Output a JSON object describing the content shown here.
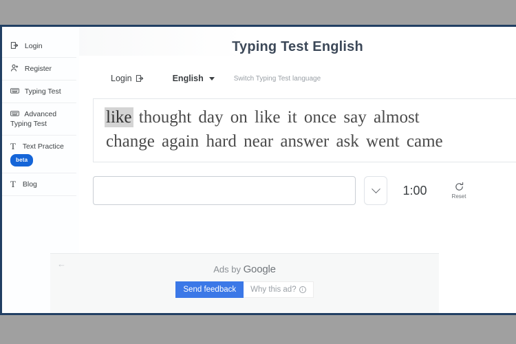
{
  "window": {
    "background_color": "#a0a0a0",
    "frame_border_color": "#213f63"
  },
  "sidebar": {
    "items": [
      {
        "id": "login",
        "label": "Login",
        "icon": "box-arrow-in-right-icon",
        "badge": null
      },
      {
        "id": "register",
        "label": "Register",
        "icon": "person-plus-icon",
        "badge": null
      },
      {
        "id": "typing-test",
        "label": "Typing Test",
        "icon": "keyboard-icon",
        "badge": null
      },
      {
        "id": "advanced-test",
        "label": "Advanced Typing Test",
        "icon": "keyboard-icon",
        "badge": null
      },
      {
        "id": "text-practice",
        "label": "Text Practice",
        "icon": "text-t-icon",
        "badge": "beta"
      },
      {
        "id": "blog",
        "label": "Blog",
        "icon": "text-t-icon",
        "badge": null
      }
    ],
    "badge_color": "#1565d8"
  },
  "main": {
    "title": "Typing Test English",
    "toolbar": {
      "login_label": "Login",
      "login_icon": "box-arrow-in-right-icon",
      "language_label": "English",
      "language_caret": "chevron-down-icon",
      "switch_hint": "Switch Typing Test language"
    },
    "word_display": {
      "current_word_index": 0,
      "highlight_color": "#d4d4d4",
      "lines": [
        [
          "like",
          "thought",
          "day",
          "on",
          "like",
          "it",
          "once",
          "say",
          "almost"
        ],
        [
          "change",
          "again",
          "hard",
          "near",
          "answer",
          "ask",
          "went",
          "came"
        ]
      ]
    },
    "input_row": {
      "typing_value": "",
      "typing_placeholder": "",
      "dropdown_icon": "chevron-down-icon",
      "timer": "1:00",
      "reset_label": "Reset",
      "reset_icon": "refresh-icon"
    }
  },
  "ads": {
    "back_arrow": "←",
    "attribution_prefix": "Ads by ",
    "attribution_brand": "Google",
    "send_feedback_label": "Send feedback",
    "send_feedback_color": "#3b78e7",
    "why_this_ad_label": "Why this ad?",
    "why_this_ad_icon": "info-circle-icon"
  }
}
